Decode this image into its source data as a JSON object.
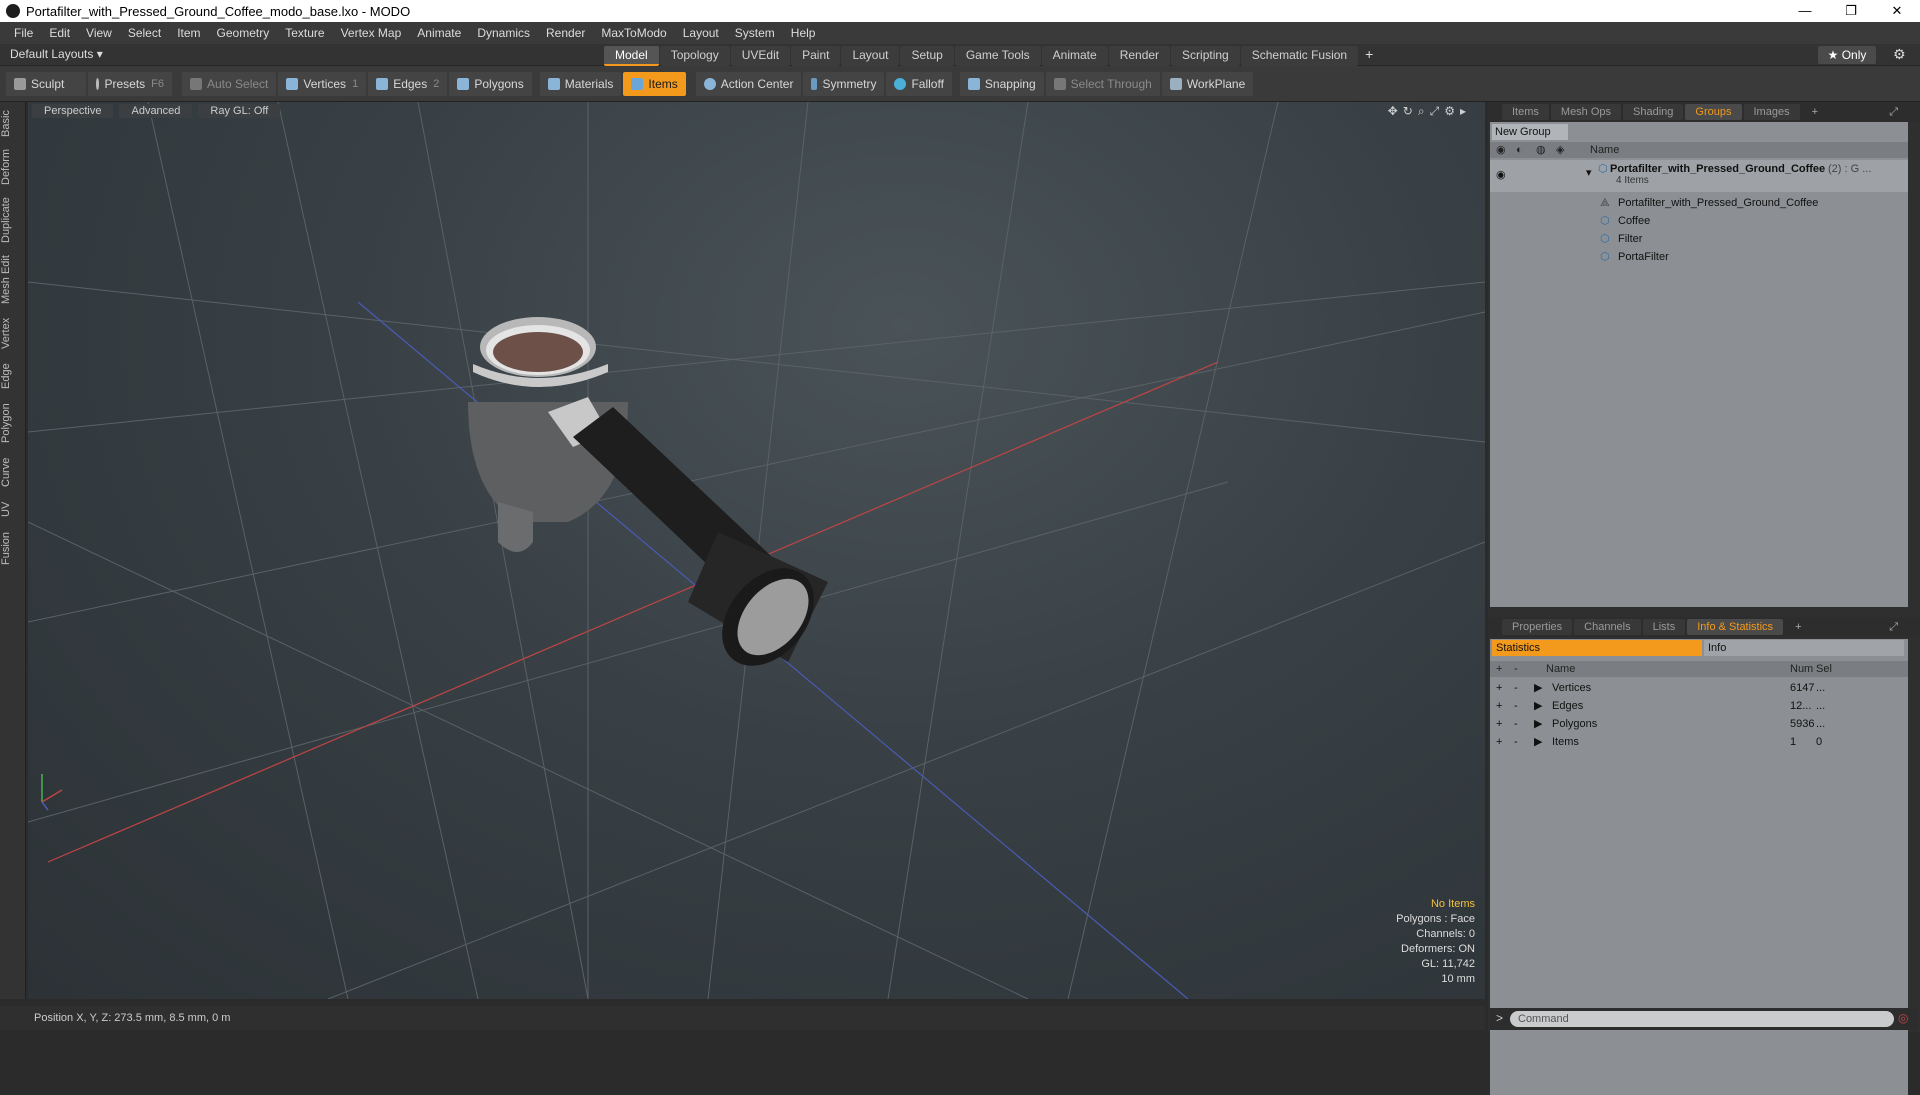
{
  "window": {
    "title": "Portafilter_with_Pressed_Ground_Coffee_modo_base.lxo - MODO"
  },
  "menu": [
    "File",
    "Edit",
    "View",
    "Select",
    "Item",
    "Geometry",
    "Texture",
    "Vertex Map",
    "Animate",
    "Dynamics",
    "Render",
    "MaxToModo",
    "Layout",
    "System",
    "Help"
  ],
  "modebar": {
    "layouts": "Default Layouts ▾",
    "tabs": [
      "Model",
      "Topology",
      "UVEdit",
      "Paint",
      "Layout",
      "Setup",
      "Game Tools",
      "Animate",
      "Render",
      "Scripting",
      "Schematic Fusion"
    ],
    "active_tab": "Model",
    "only": "★ Only"
  },
  "toolbar": {
    "sculpt": "Sculpt",
    "presets": "Presets",
    "presets_key": "F6",
    "auto_select": "Auto Select",
    "vertices": "Vertices",
    "vertices_key": "1",
    "edges": "Edges",
    "edges_key": "2",
    "polygons": "Polygons",
    "materials": "Materials",
    "items": "Items",
    "action_center": "Action Center",
    "symmetry": "Symmetry",
    "falloff": "Falloff",
    "snapping": "Snapping",
    "select_through": "Select Through",
    "workplane": "WorkPlane"
  },
  "left_tabs": [
    "Basic",
    "Deform",
    "Duplicate",
    "Mesh Edit",
    "Vertex",
    "Edge",
    "Polygon",
    "Curve",
    "UV",
    "Fusion"
  ],
  "viewport": {
    "view": "Perspective",
    "shading": "Advanced",
    "raygl": "Ray GL: Off",
    "info": {
      "selection": "No Items",
      "polygons": "Polygons : Face",
      "channels": "Channels: 0",
      "deformers": "Deformers: ON",
      "gl": "GL: 11,742",
      "scale": "10 mm"
    }
  },
  "status": {
    "position": "Position X, Y, Z:  273.5 mm, 8.5 mm, 0 m"
  },
  "groups_panel": {
    "tabs": [
      "Items",
      "Mesh Ops",
      "Shading",
      "Groups",
      "Images"
    ],
    "active_tab": "Groups",
    "new_group": "New Group",
    "col_name": "Name",
    "root": {
      "name": "Portafilter_with_Pressed_Ground_Coffee",
      "suffix": "(2) : G ...",
      "count": "4 Items"
    },
    "children": [
      "Portafilter_with_Pressed_Ground_Coffee",
      "Coffee",
      "Filter",
      "PortaFilter"
    ]
  },
  "info_panel": {
    "tabs": [
      "Properties",
      "Channels",
      "Lists",
      "Info & Statistics"
    ],
    "active_tab": "Info & Statistics",
    "sub_tabs": [
      "Statistics",
      "Info"
    ],
    "cols": [
      "Name",
      "Num",
      "Sel"
    ],
    "rows": [
      {
        "name": "Vertices",
        "num": "6147",
        "sel": "..."
      },
      {
        "name": "Edges",
        "num": "12...",
        "sel": "..."
      },
      {
        "name": "Polygons",
        "num": "5936",
        "sel": "..."
      },
      {
        "name": "Items",
        "num": "1",
        "sel": "0"
      }
    ]
  },
  "command": {
    "placeholder": "Command"
  }
}
